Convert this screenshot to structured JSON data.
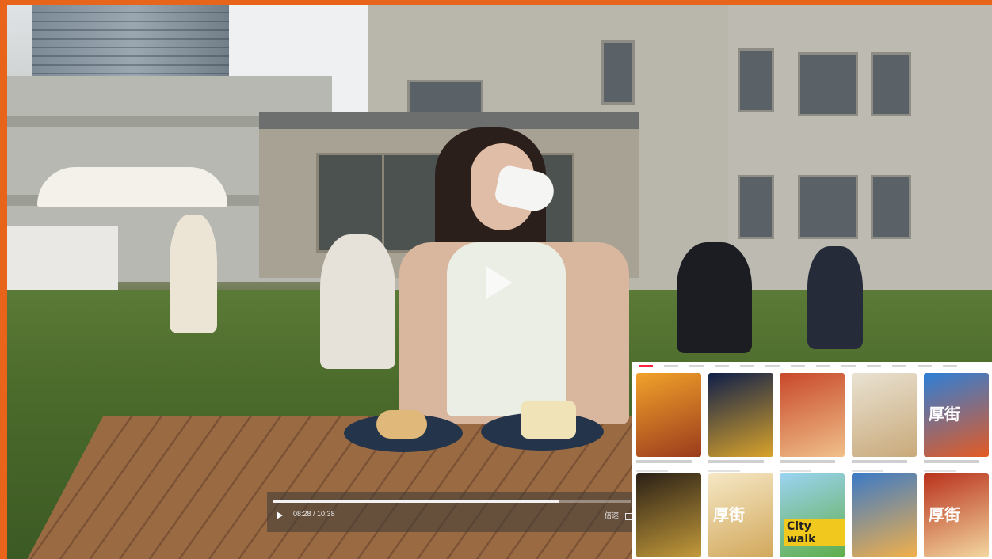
{
  "player": {
    "current_time": "08:28",
    "duration": "10:38",
    "time_separator": " / ",
    "speed_label": "倍速",
    "progress_fraction": 0.797
  },
  "overlay": {
    "cards": [
      {
        "text": "",
        "colors": [
          "#f1a22a",
          "#9b3b1d"
        ]
      },
      {
        "text": "",
        "colors": [
          "#0f1f4a",
          "#d9a32a"
        ]
      },
      {
        "text": "",
        "colors": [
          "#c8482a",
          "#f0c08a"
        ]
      },
      {
        "text": "",
        "colors": [
          "#e9e2d2",
          "#c9a97a"
        ]
      },
      {
        "text": "厚街",
        "colors": [
          "#2d7fd8",
          "#e45a23"
        ]
      },
      {
        "text": "",
        "colors": [
          "#2a2016",
          "#c39a3a"
        ]
      },
      {
        "text": "厚街",
        "colors": [
          "#f5e7c4",
          "#d2a85c"
        ]
      },
      {
        "text": "City walk",
        "colors": [
          "#9bd3f2",
          "#5fae4a"
        ]
      },
      {
        "text": "",
        "colors": [
          "#3c7ac6",
          "#f2b04a"
        ]
      },
      {
        "text": "厚街",
        "colors": [
          "#b9321c",
          "#f3d7a0"
        ]
      }
    ]
  },
  "colors": {
    "frame": "#e8641a",
    "accent": "#ff2442"
  }
}
